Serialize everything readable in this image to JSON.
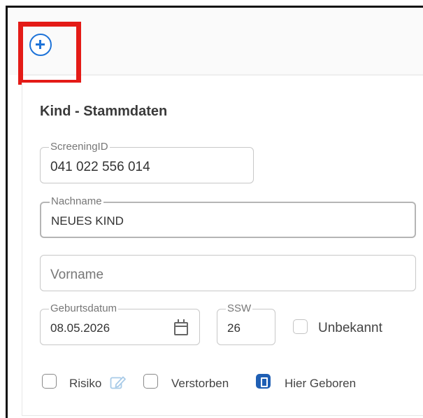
{
  "toolbar": {
    "add_icon": "plus-circle-icon"
  },
  "form": {
    "title": "Kind - Stammdaten",
    "screening_id": {
      "label": "ScreeningID",
      "value": "041 022 556 014"
    },
    "nachname": {
      "label": "Nachname",
      "value": "NEUES KIND"
    },
    "vorname": {
      "placeholder": "Vorname"
    },
    "geburtsdatum": {
      "label": "Geburtsdatum",
      "value": "08.05.2026",
      "icon": "calendar-icon"
    },
    "ssw": {
      "label": "SSW",
      "value": "26"
    },
    "unbekannt": {
      "label": "Unbekannt",
      "checked": false,
      "disabled": true
    },
    "risiko": {
      "label": "Risiko",
      "checked": false,
      "icon": "edit-icon"
    },
    "verstorben": {
      "label": "Verstorben",
      "checked": false
    },
    "hier_geboren": {
      "label": "Hier Geboren",
      "checked": true
    }
  },
  "colors": {
    "accent": "#1e73d8",
    "highlight": "#e41b17",
    "checkbox_checked": "#1f5fb4"
  }
}
